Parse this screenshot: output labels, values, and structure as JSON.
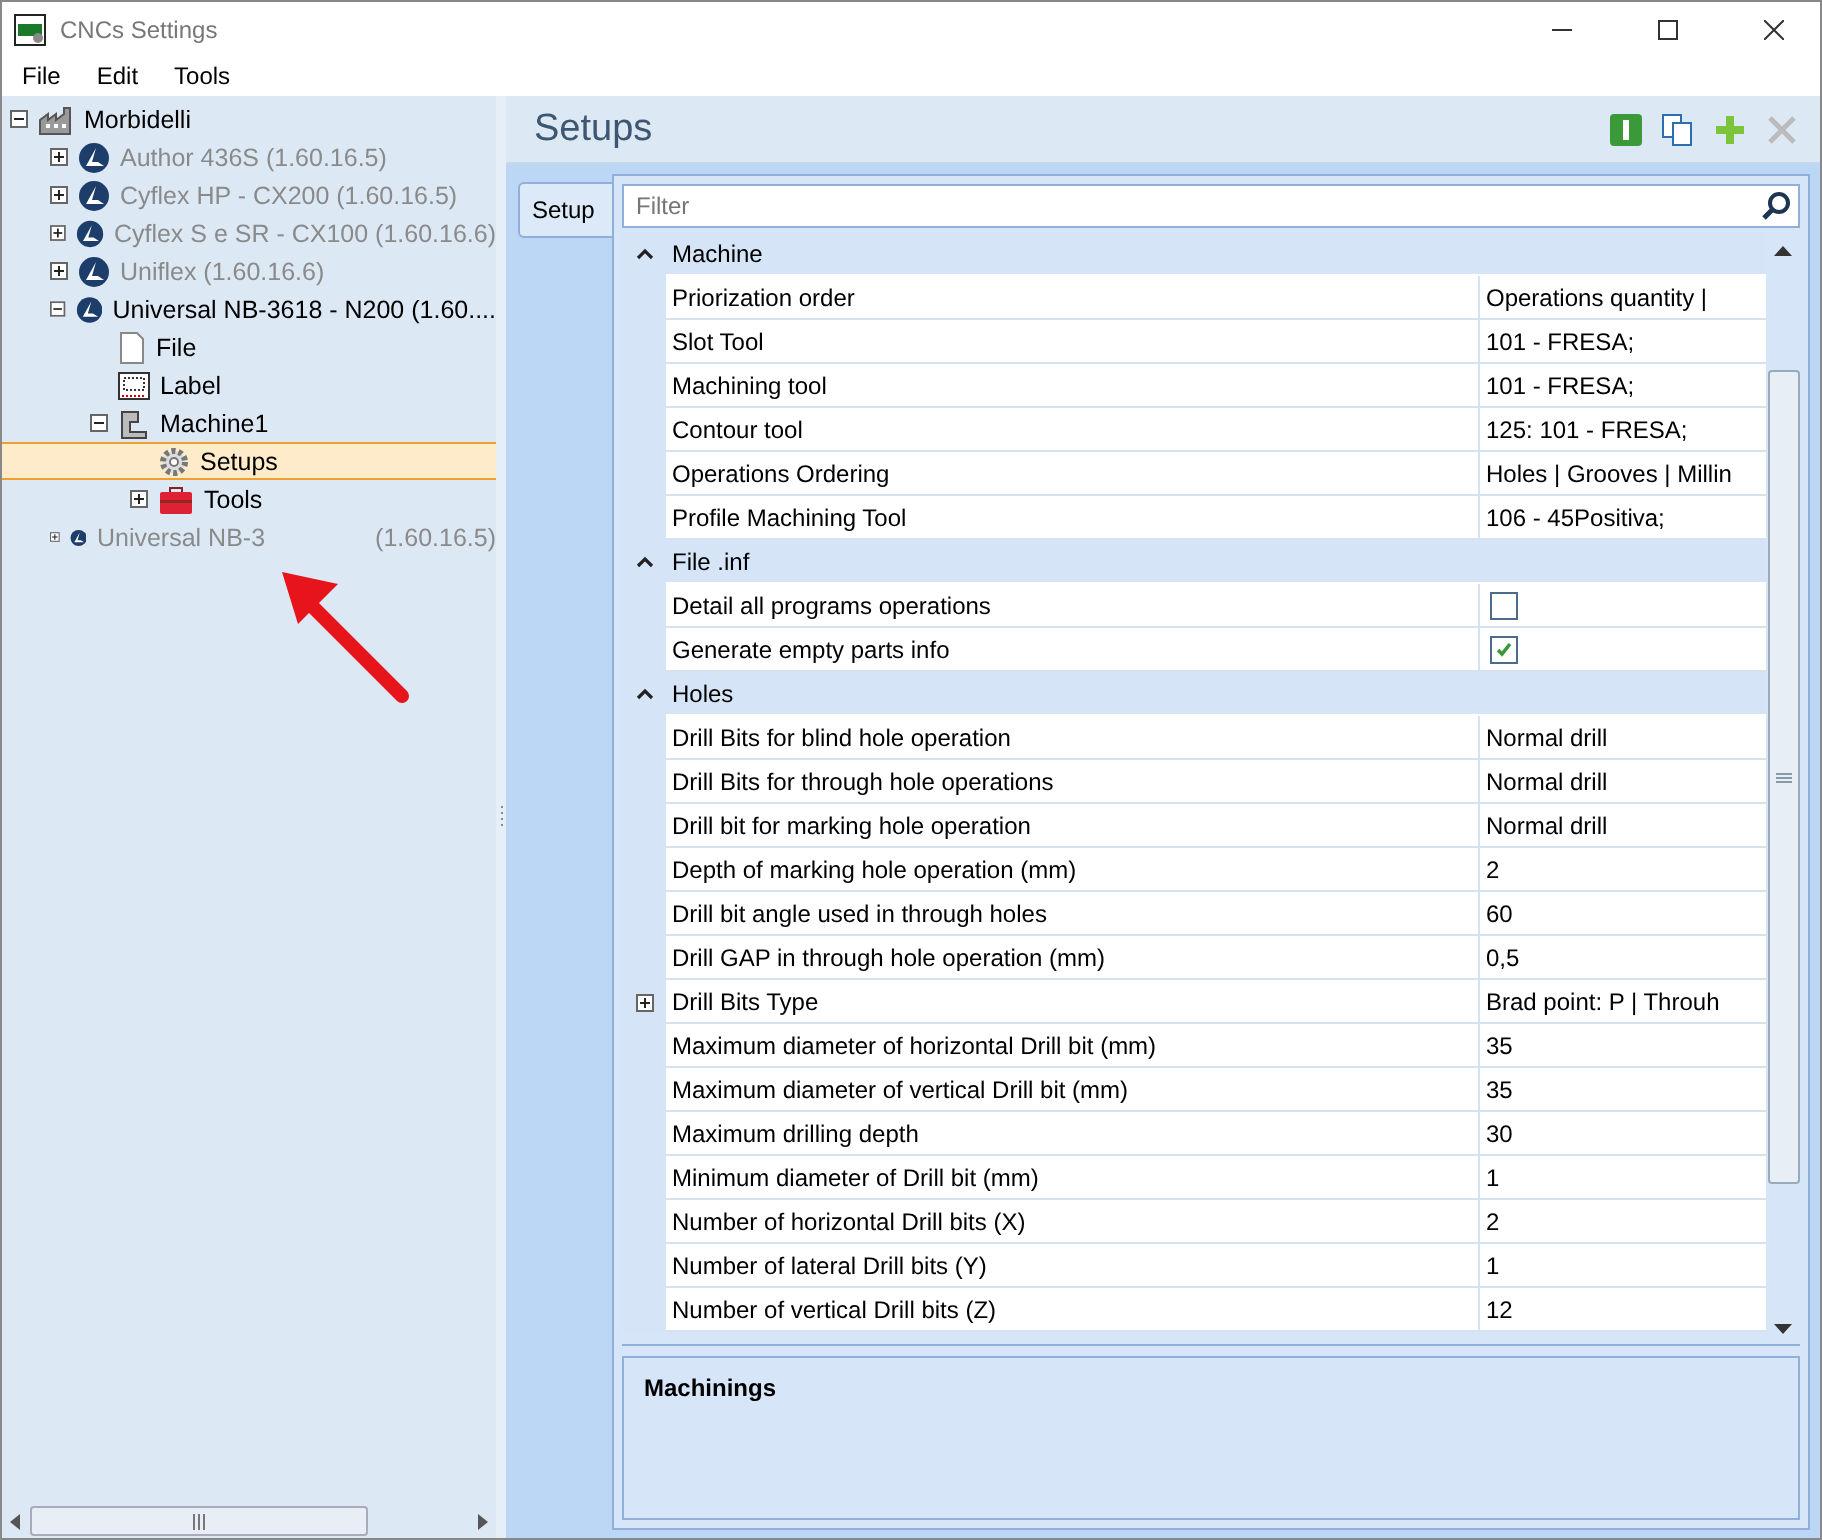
{
  "window": {
    "title": "CNCs Settings"
  },
  "menu": [
    "File",
    "Edit",
    "Tools"
  ],
  "tree": [
    {
      "label": "Morbidelli",
      "kind": "factory",
      "expandable": true,
      "expanded": true,
      "disabled": false,
      "selected": false,
      "children": [
        {
          "label": "Author 436S (1.60.16.5)",
          "kind": "brand",
          "expandable": true,
          "expanded": false,
          "disabled": true,
          "selected": false
        },
        {
          "label": "Cyflex HP - CX200 (1.60.16.5)",
          "kind": "brand",
          "expandable": true,
          "expanded": false,
          "disabled": true,
          "selected": false
        },
        {
          "label": "Cyflex S e SR - CX100 (1.60.16.6)",
          "kind": "brand",
          "expandable": true,
          "expanded": false,
          "disabled": true,
          "selected": false
        },
        {
          "label": "Uniflex (1.60.16.6)",
          "kind": "brand",
          "expandable": true,
          "expanded": false,
          "disabled": true,
          "selected": false
        },
        {
          "label": "Universal NB-3618 - N200 (1.60....",
          "kind": "brand",
          "expandable": true,
          "expanded": true,
          "disabled": false,
          "selected": false,
          "children": [
            {
              "label": "File",
              "kind": "file",
              "expandable": false,
              "disabled": false,
              "selected": false
            },
            {
              "label": "Label",
              "kind": "label",
              "expandable": false,
              "disabled": false,
              "selected": false
            },
            {
              "label": "Machine1",
              "kind": "machine",
              "expandable": true,
              "expanded": true,
              "disabled": false,
              "selected": false,
              "children": [
                {
                  "label": "Setups",
                  "kind": "gear",
                  "expandable": false,
                  "disabled": false,
                  "selected": true
                },
                {
                  "label": "Tools",
                  "kind": "toolbox",
                  "expandable": true,
                  "expanded": false,
                  "disabled": false,
                  "selected": false
                }
              ]
            }
          ]
        },
        {
          "label": "Universal NB-3",
          "suffix": "(1.60.16.5)",
          "kind": "brand",
          "expandable": true,
          "expanded": false,
          "disabled": true,
          "selected": false
        }
      ]
    }
  ],
  "panel": {
    "title": "Setups",
    "toolbar": [
      {
        "kind": "info",
        "disabled": false
      },
      {
        "kind": "copy",
        "disabled": false
      },
      {
        "kind": "add",
        "disabled": false
      },
      {
        "kind": "delete",
        "disabled": true
      }
    ],
    "tabs": [
      {
        "label": "Setup",
        "selected": true
      }
    ],
    "filter": {
      "placeholder": "Filter"
    },
    "grid": [
      {
        "kind": "category",
        "label": "Machine",
        "expanded": true
      },
      {
        "kind": "text",
        "name": "Priorization order",
        "value": "Operations quantity |"
      },
      {
        "kind": "text",
        "name": "Slot Tool",
        "value": "101 - FRESA;"
      },
      {
        "kind": "text",
        "name": "Machining tool",
        "value": "101 - FRESA;"
      },
      {
        "kind": "text",
        "name": "Contour tool",
        "value": "125: 101 - FRESA;"
      },
      {
        "kind": "text",
        "name": "Operations Ordering",
        "value": "Holes | Grooves | Millin"
      },
      {
        "kind": "text",
        "name": "Profile Machining Tool",
        "value": "106 - 45Positiva;"
      },
      {
        "kind": "category",
        "label": "File .inf",
        "expanded": true
      },
      {
        "kind": "checkbox",
        "name": "Detail all programs operations",
        "checked": false
      },
      {
        "kind": "checkbox",
        "name": "Generate empty parts info",
        "checked": true
      },
      {
        "kind": "category",
        "label": "Holes",
        "expanded": true
      },
      {
        "kind": "text",
        "name": "Drill Bits for blind hole operation",
        "value": "Normal drill"
      },
      {
        "kind": "text",
        "name": "Drill Bits for through hole operations",
        "value": "Normal drill"
      },
      {
        "kind": "text",
        "name": "Drill bit for marking hole operation",
        "value": "Normal drill"
      },
      {
        "kind": "text",
        "name": "Depth of marking hole operation (mm)",
        "value": "2"
      },
      {
        "kind": "text",
        "name": "Drill bit angle used in through holes",
        "value": "60"
      },
      {
        "kind": "text",
        "name": "Drill GAP in through hole operation (mm)",
        "value": "0,5"
      },
      {
        "kind": "expandable",
        "name": "Drill Bits Type",
        "value": "Brad point: P  |  Throuh",
        "expanded": false
      },
      {
        "kind": "text",
        "name": "Maximum diameter of horizontal Drill bit (mm)",
        "value": "35"
      },
      {
        "kind": "text",
        "name": "Maximum diameter of vertical Drill bit (mm)",
        "value": "35"
      },
      {
        "kind": "text",
        "name": "Maximum drilling depth",
        "value": "30"
      },
      {
        "kind": "text",
        "name": "Minimum diameter of Drill bit (mm)",
        "value": "1"
      },
      {
        "kind": "text",
        "name": "Number of horizontal Drill bits (X)",
        "value": "2"
      },
      {
        "kind": "text",
        "name": "Number of lateral Drill bits (Y)",
        "value": "1"
      },
      {
        "kind": "text",
        "name": "Number of vertical Drill bits (Z)",
        "value": "12"
      }
    ],
    "description": {
      "title": "Machinings"
    }
  }
}
